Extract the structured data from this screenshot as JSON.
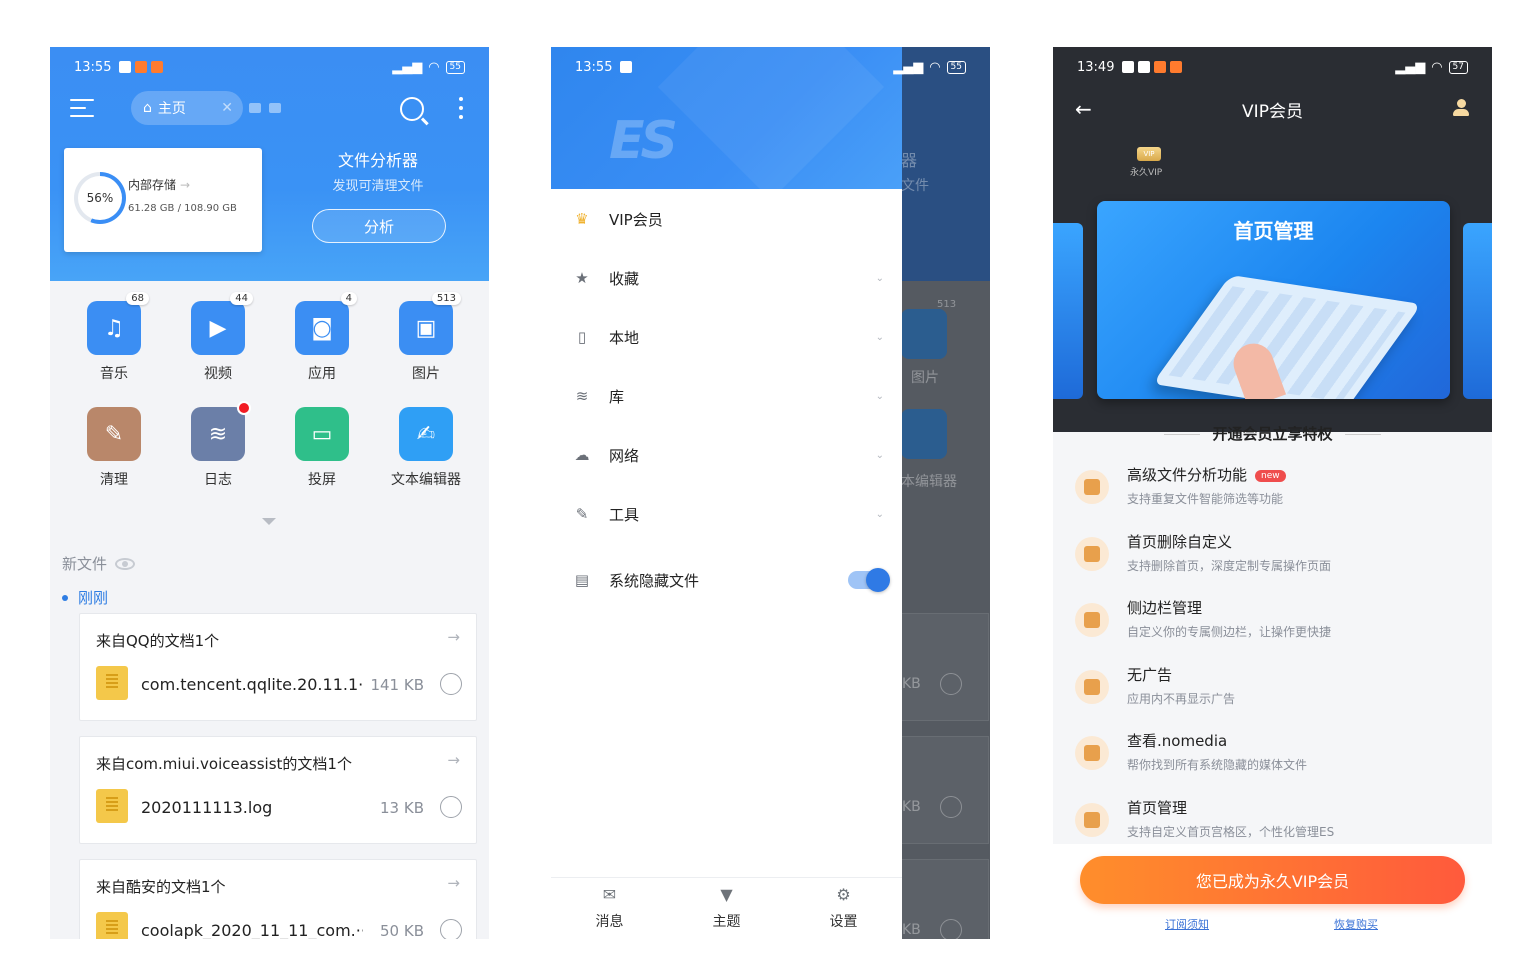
{
  "phone1": {
    "status": {
      "time": "13:55",
      "battery": "55"
    },
    "tab_label": "主页",
    "storage": {
      "percent": "56%",
      "name": "内部存储",
      "size": "61.28 GB / 108.90 GB"
    },
    "analyzer": {
      "title": "文件分析器",
      "subtitle": "发现可清理文件",
      "button": "分析"
    },
    "shortcuts": [
      {
        "label": "音乐",
        "badge": "68",
        "color": "#3b8ef3",
        "icon": "music-note-icon"
      },
      {
        "label": "视频",
        "badge": "44",
        "color": "#3b8ef3",
        "icon": "video-icon"
      },
      {
        "label": "应用",
        "badge": "4",
        "color": "#3b8ef3",
        "icon": "android-icon"
      },
      {
        "label": "图片",
        "badge": "513",
        "color": "#3b8ef3",
        "icon": "image-icon"
      },
      {
        "label": "清理",
        "badge": "",
        "color": "#b9876a",
        "icon": "broom-icon"
      },
      {
        "label": "日志",
        "badge": "",
        "color": "#6b7fa8",
        "icon": "log-icon"
      },
      {
        "label": "投屏",
        "badge": "",
        "color": "#2fbf8a",
        "icon": "cast-icon"
      },
      {
        "label": "文本编辑器",
        "badge": "",
        "color": "#2f9ff5",
        "icon": "text-editor-icon"
      }
    ],
    "new_files_label": "新文件",
    "just_now": "刚刚",
    "cards": [
      {
        "title": "来自QQ的文档1个",
        "file": "com.tencent.qqlite.20.11.1···",
        "size": "141 KB"
      },
      {
        "title": "来自com.miui.voiceassist的文档1个",
        "file": "2020111113.log",
        "size": "13 KB"
      },
      {
        "title": "来自酷安的文档1个",
        "file": "coolapk_2020_11_11_com.···",
        "size": "50 KB"
      }
    ]
  },
  "phone2": {
    "status": {
      "time": "13:55",
      "battery": "55"
    },
    "logo": "ES",
    "menu": [
      {
        "label": "VIP会员",
        "icon": "crown-icon",
        "chevron": false
      },
      {
        "label": "收藏",
        "icon": "star-icon",
        "chevron": true
      },
      {
        "label": "本地",
        "icon": "phone-icon",
        "chevron": true
      },
      {
        "label": "库",
        "icon": "layers-icon",
        "chevron": true
      },
      {
        "label": "网络",
        "icon": "network-icon",
        "chevron": true
      },
      {
        "label": "工具",
        "icon": "wrench-icon",
        "chevron": true
      }
    ],
    "hidden_files": {
      "label": "系统隐藏文件",
      "enabled": true
    },
    "footer": [
      {
        "label": "消息",
        "icon": "message-icon"
      },
      {
        "label": "主题",
        "icon": "shirt-icon"
      },
      {
        "label": "设置",
        "icon": "gear-icon"
      }
    ],
    "ghost": {
      "title_frag": "器",
      "sub_frag": "文件",
      "badge": "513",
      "img_label": "图片",
      "editor_label": "本编辑器",
      "size1": "KB",
      "size2": "KB",
      "size3": "KB"
    }
  },
  "phone3": {
    "status": {
      "time": "13:49",
      "battery": "57"
    },
    "title": "VIP会员",
    "vip_chip": "VIP",
    "vip_type": "永久VIP",
    "banner_title": "首页管理",
    "privileges_title": "开通会员立享特权",
    "perks": [
      {
        "title": "高级文件分析功能",
        "desc": "支持重复文件智能筛选等功能",
        "tag": "new"
      },
      {
        "title": "首页删除自定义",
        "desc": "支持删除首页，深度定制专属操作页面",
        "tag": ""
      },
      {
        "title": "侧边栏管理",
        "desc": "自定义你的专属侧边栏，让操作更快捷",
        "tag": ""
      },
      {
        "title": "无广告",
        "desc": "应用内不再显示广告",
        "tag": ""
      },
      {
        "title": "查看.nomedia",
        "desc": "帮你找到所有系统隐藏的媒体文件",
        "tag": ""
      },
      {
        "title": "首页管理",
        "desc": "支持自定义首页宫格区，个性化管理ES",
        "tag": ""
      }
    ],
    "cta": "您已成为永久VIP会员",
    "links": {
      "terms": "订阅须知",
      "restore": "恢复购买"
    }
  }
}
